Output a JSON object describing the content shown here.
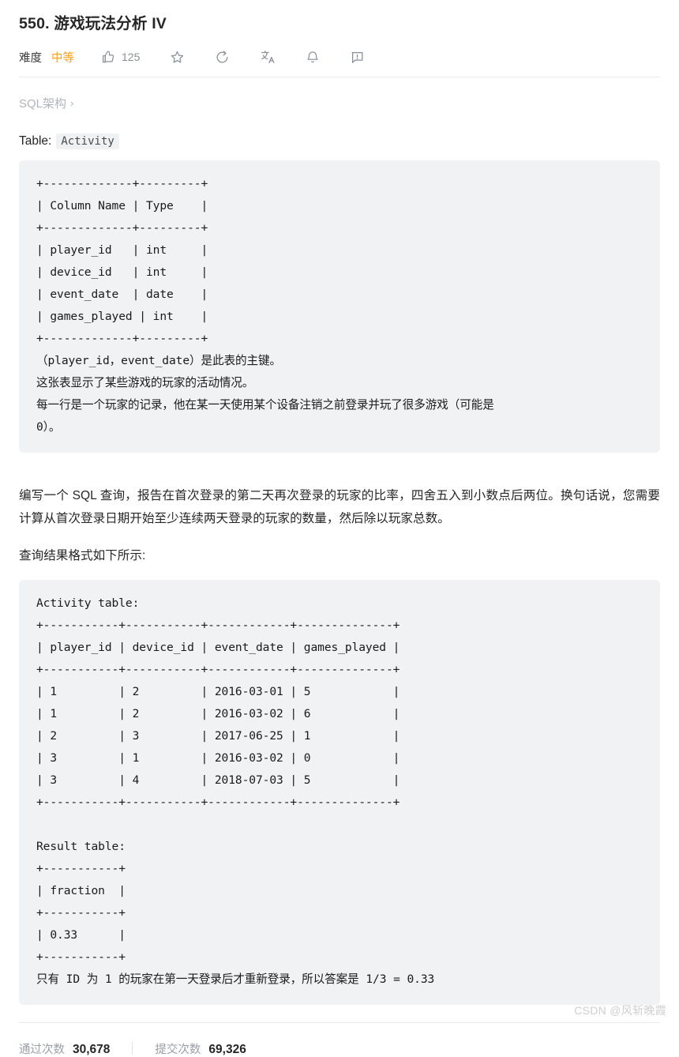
{
  "header": {
    "title": "550. 游戏玩法分析 IV",
    "difficulty_label": "难度",
    "difficulty_value": "中等",
    "like_count": "125",
    "icons": {
      "like": "thumbs-up-icon",
      "star": "star-icon",
      "share": "share-circle-icon",
      "translate": "translate-icon",
      "bell": "bell-icon",
      "comment": "comment-alert-icon"
    },
    "accent_color": "#ffa116"
  },
  "breadcrumb": {
    "label": "SQL架构",
    "chevron": "›"
  },
  "table_intro": {
    "prefix": "Table:",
    "table_name": "Activity"
  },
  "schema_block": "+-------------+---------+\n| Column Name | Type    |\n+-------------+---------+\n| player_id   | int     |\n| device_id   | int     |\n| event_date  | date    |\n| games_played | int    |\n+-------------+---------+\n（player_id，event_date）是此表的主键。\n这张表显示了某些游戏的玩家的活动情况。\n每一行是一个玩家的记录，他在某一天使用某个设备注销之前登录并玩了很多游戏（可能是\n0）。",
  "question": {
    "paragraph": "编写一个 SQL 查询，报告在首次登录的第二天再次登录的玩家的比率，四舍五入到小数点后两位。换句话说，您需要计算从首次登录日期开始至少连续两天登录的玩家的数量，然后除以玩家总数。",
    "format_line": "查询结果格式如下所示:"
  },
  "example_block": "Activity table:\n+-----------+-----------+------------+--------------+\n| player_id | device_id | event_date | games_played |\n+-----------+-----------+------------+--------------+\n| 1         | 2         | 2016-03-01 | 5            |\n| 1         | 2         | 2016-03-02 | 6            |\n| 2         | 3         | 2017-06-25 | 1            |\n| 3         | 1         | 2016-03-02 | 0            |\n| 3         | 4         | 2018-07-03 | 5            |\n+-----------+-----------+------------+--------------+\n\nResult table:\n+-----------+\n| fraction  |\n+-----------+\n| 0.33      |\n+-----------+\n只有 ID 为 1 的玩家在第一天登录后才重新登录，所以答案是 1/3 = 0.33",
  "stats": {
    "accepted_label": "通过次数",
    "accepted_value": "30,678",
    "submissions_label": "提交次数",
    "submissions_value": "69,326"
  },
  "watermark": "CSDN @风斩晚霞"
}
